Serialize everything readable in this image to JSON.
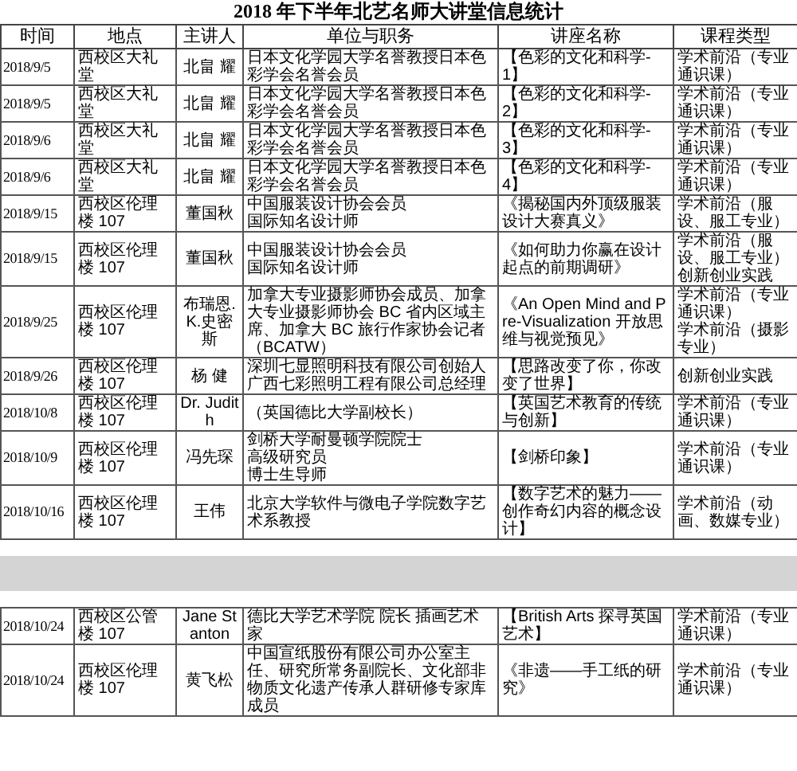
{
  "document": {
    "title": "2018 年下半年北艺名师大讲堂信息统计",
    "columns": [
      "时间",
      "地点",
      "主讲人",
      "单位与职务",
      "讲座名称",
      "课程类型"
    ],
    "pages": [
      {
        "rows": [
          {
            "cells": [
              [
                "2018/9/5"
              ],
              [
                "西校区大礼堂"
              ],
              [
                "北畠 耀"
              ],
              [
                "日本文化学园大学名誉教授日本色彩学会名誉会员"
              ],
              [
                "【色彩的文化和科学-1】"
              ],
              [
                "学术前沿（专业通识课）"
              ]
            ]
          },
          {
            "cells": [
              [
                "2018/9/5"
              ],
              [
                "西校区大礼堂"
              ],
              [
                "北畠 耀"
              ],
              [
                "日本文化学园大学名誉教授日本色彩学会名誉会员"
              ],
              [
                "【色彩的文化和科学-2】"
              ],
              [
                "学术前沿（专业通识课）"
              ]
            ]
          },
          {
            "cells": [
              [
                "2018/9/6"
              ],
              [
                "西校区大礼堂"
              ],
              [
                "北畠 耀"
              ],
              [
                "日本文化学园大学名誉教授日本色彩学会名誉会员"
              ],
              [
                "【色彩的文化和科学-3】"
              ],
              [
                "学术前沿（专业通识课）"
              ]
            ]
          },
          {
            "cells": [
              [
                "2018/9/6"
              ],
              [
                "西校区大礼堂"
              ],
              [
                "北畠 耀"
              ],
              [
                "日本文化学园大学名誉教授日本色彩学会名誉会员"
              ],
              [
                "【色彩的文化和科学-4】"
              ],
              [
                "学术前沿（专业通识课）"
              ]
            ]
          },
          {
            "cells": [
              [
                "2018/9/15"
              ],
              [
                "西校区伦理楼 107"
              ],
              [
                "董国秋"
              ],
              [
                "中国服装设计协会会员",
                "国际知名设计师"
              ],
              [
                "《揭秘国内外顶级服装设计大赛真义》"
              ],
              [
                "学术前沿（服设、服工专业）"
              ]
            ]
          },
          {
            "cells": [
              [
                "2018/9/15"
              ],
              [
                "西校区伦理楼 107"
              ],
              [
                "董国秋"
              ],
              [
                "中国服装设计协会会员",
                "国际知名设计师"
              ],
              [
                "《如何助力你赢在设计起点的前期调研》"
              ],
              [
                "学术前沿（服设、服工专业）",
                "创新创业实践"
              ]
            ]
          },
          {
            "cells": [
              [
                "2018/9/25"
              ],
              [
                "西校区伦理楼 107"
              ],
              [
                "布瑞恩.K.史密斯"
              ],
              [
                "加拿大专业摄影师协会成员、加拿大专业摄影师协会 BC 省内区域主席、加拿大 BC 旅行作家协会记者（BCATW）"
              ],
              [
                "《An Open Mind and Pre-Visualization 开放思维与视觉预见》"
              ],
              [
                "学术前沿（专业通识课）",
                "学术前沿（摄影专业）"
              ]
            ]
          },
          {
            "cells": [
              [
                "2018/9/26"
              ],
              [
                "西校区伦理楼 107"
              ],
              [
                "杨 健"
              ],
              [
                "深圳七显照明科技有限公司创始人",
                "广西七彩照明工程有限公司总经理"
              ],
              [
                "【思路改变了你，你改变了世界】"
              ],
              [
                "创新创业实践"
              ]
            ]
          },
          {
            "cells": [
              [
                "2018/10/8"
              ],
              [
                "西校区伦理楼 107"
              ],
              [
                "Dr. Judith"
              ],
              [
                "（英国德比大学副校长）"
              ],
              [
                "【英国艺术教育的传统与创新】"
              ],
              [
                "学术前沿（专业通识课）"
              ]
            ]
          },
          {
            "cells": [
              [
                "2018/10/9"
              ],
              [
                "西校区伦理楼 107"
              ],
              [
                "冯先琛"
              ],
              [
                "剑桥大学耐曼顿学院院士",
                "高级研究员",
                "博士生导师"
              ],
              [
                "【剑桥印象】"
              ],
              [
                "学术前沿（专业通识课）"
              ]
            ]
          },
          {
            "cells": [
              [
                "2018/10/16"
              ],
              [
                "西校区伦理楼 107"
              ],
              [
                "王伟"
              ],
              [
                "北京大学软件与微电子学院数字艺术系教授"
              ],
              [
                "【数字艺术的魅力——创作奇幻内容的概念设计】"
              ],
              [
                "学术前沿（动画、数媒专业）"
              ]
            ]
          }
        ]
      },
      {
        "rows": [
          {
            "cells": [
              [
                "2018/10/24"
              ],
              [
                "西校区公管楼 107"
              ],
              [
                "Jane Stanton"
              ],
              [
                "德比大学艺术学院 院长 插画艺术家"
              ],
              [
                "【British Arts 探寻英国艺术】"
              ],
              [
                "学术前沿（专业通识课）"
              ]
            ]
          },
          {
            "cells": [
              [
                "2018/10/24"
              ],
              [
                "西校区伦理楼 107"
              ],
              [
                "黄飞松"
              ],
              [
                "中国宣纸股份有限公司办公室主任、研究所常务副院长、文化部非物质文化遗产传承人群研修专家库成员"
              ],
              [
                "《非遗——手工纸的研究》"
              ],
              [
                "学术前沿（专业通识课）"
              ]
            ]
          }
        ]
      }
    ]
  }
}
